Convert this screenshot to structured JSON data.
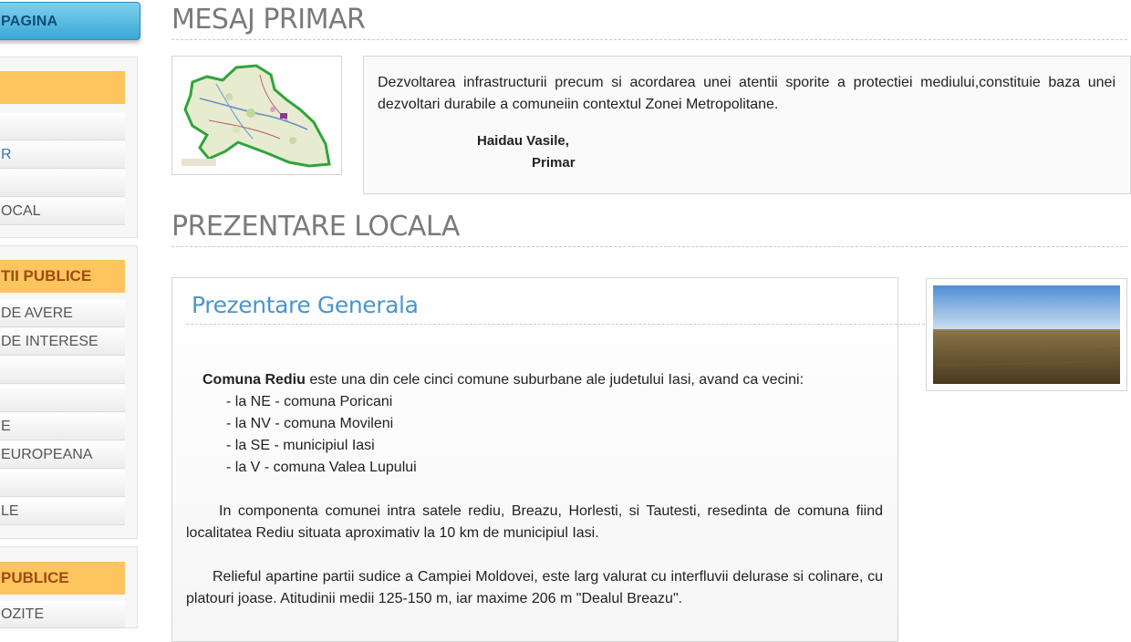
{
  "sidebar": {
    "home_label": "PAGINA",
    "panel1": {
      "items": [
        "",
        "R",
        "",
        "OCAL"
      ]
    },
    "panel2": {
      "header": "TII PUBLICE",
      "items": [
        "DE AVERE",
        "DE INTERESE",
        "",
        "",
        "E",
        "EUROPEANA",
        "",
        "LE"
      ]
    },
    "panel3": {
      "header": "PUBLICE",
      "items": [
        "OZITE"
      ]
    }
  },
  "mesaj": {
    "title": "MESAJ PRIMAR",
    "text": "Dezvoltarea infrastructurii precum si acordarea unei atentii sporite a protectiei mediului,constituie baza unei dezvoltari durabile a comuneiin contextul Zonei Metropolitane.",
    "signature_name": "Haidau Vasile,",
    "signature_role": "Primar"
  },
  "prezentare": {
    "title": "PREZENTARE LOCALA",
    "subtitle": "Prezentare Generala",
    "intro_bold": "Comuna Rediu",
    "intro_rest": " este una din cele cinci comune suburbane ale judetului Iasi, avand ca vecini:",
    "neighbors": [
      "- la NE - comuna Poricani",
      "- la NV - comuna Movileni",
      "- la SE - municipiul Iasi",
      "- la V - comuna Valea Lupului"
    ],
    "para2": "In componenta comunei intra satele rediu, Breazu, Horlesti, si Tautesti, resedinta de comuna fiind localitatea Rediu situata aproximativ la 10 km de municipiul Iasi.",
    "para3": "Relieful apartine partii sudice a Campiei Moldovei, este larg valurat cu interfluvii delurase si colinare, cu platouri joase. Atitudinii medii 125-150 m, iar maxime 206 m \"Dealul Breazu\"."
  },
  "colors": {
    "accent_blue": "#4b96c6",
    "header_orange": "#fdc55e",
    "home_button": "#3aa7d6"
  }
}
